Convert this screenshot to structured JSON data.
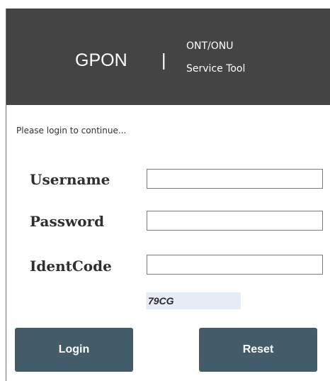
{
  "header": {
    "brand": "GPON",
    "separator": "|",
    "subtitle_line1": "ONT/ONU",
    "subtitle_line2": "Service Tool",
    "background": "#444444"
  },
  "login": {
    "hint": "Please login to continue...",
    "username_label": "Username",
    "username_value": "",
    "password_label": "Password",
    "password_value": "",
    "identcode_label": "IdentCode",
    "identcode_value": "",
    "captcha": "79CG"
  },
  "buttons": {
    "login": "Login",
    "reset": "Reset",
    "color": "#445c69"
  }
}
